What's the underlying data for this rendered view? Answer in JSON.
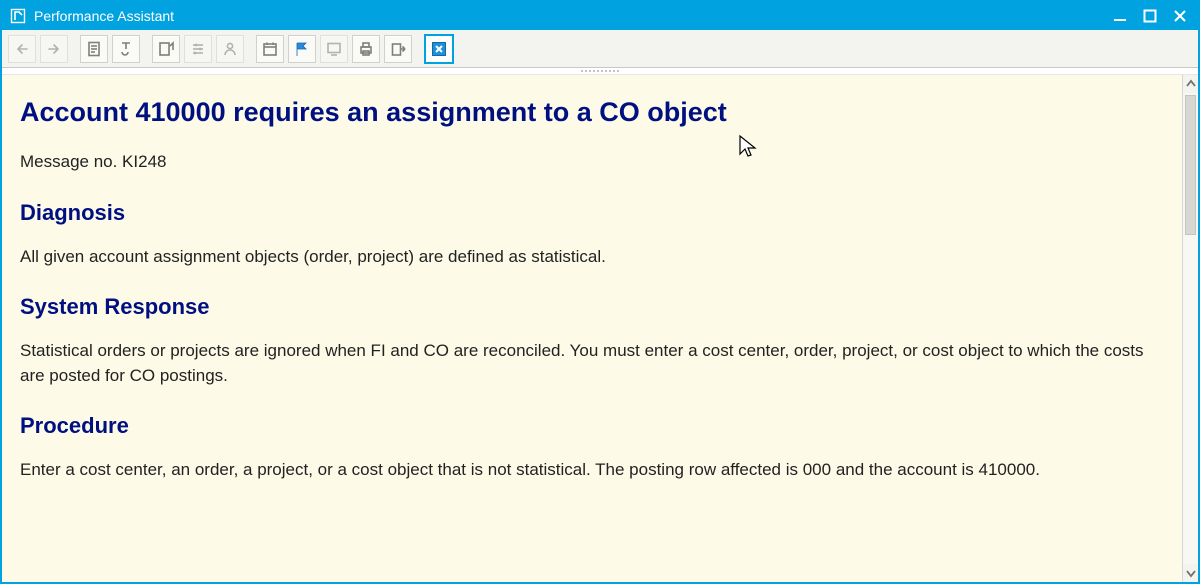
{
  "window": {
    "title": "Performance Assistant"
  },
  "toolbar_buttons": [
    {
      "name": "back-button",
      "icon": "arrow-left-icon",
      "disabled": true
    },
    {
      "name": "forward-button",
      "icon": "arrow-right-icon",
      "disabled": true
    },
    {
      "_sep": true
    },
    {
      "name": "document-button",
      "icon": "document-icon"
    },
    {
      "name": "technical-info-button",
      "icon": "wrench-t-icon"
    },
    {
      "_sep": true
    },
    {
      "name": "page-up-button",
      "icon": "page-arrow-icon"
    },
    {
      "name": "customize-button",
      "icon": "sliders-icon",
      "disabled": true
    },
    {
      "name": "user-button",
      "icon": "person-icon",
      "disabled": true
    },
    {
      "_sep": true
    },
    {
      "name": "calendar-button",
      "icon": "calendar-icon"
    },
    {
      "name": "bookmark-button",
      "icon": "flag-icon"
    },
    {
      "name": "screen-button",
      "icon": "screen-icon",
      "disabled": true
    },
    {
      "name": "print-button",
      "icon": "printer-icon"
    },
    {
      "name": "export-button",
      "icon": "export-icon"
    },
    {
      "_sep": true
    },
    {
      "name": "close-help-button",
      "icon": "close-box-icon",
      "highlight": true
    }
  ],
  "message": {
    "title": "Account 410000 requires an assignment to a CO object",
    "message_no": "Message no. KI248",
    "sections": {
      "diagnosis": {
        "heading": "Diagnosis",
        "body": "All given account assignment objects (order, project) are defined as statistical."
      },
      "system_response": {
        "heading": "System Response",
        "body": "Statistical orders or projects are ignored when FI and CO are reconciled. You must enter a cost center, order, project, or cost object to which the costs are posted for CO postings."
      },
      "procedure": {
        "heading": "Procedure",
        "body": "Enter a cost center, an order, a project, or a cost object that is not statistical. The posting row affected is 000 and the account is 410000."
      }
    }
  }
}
